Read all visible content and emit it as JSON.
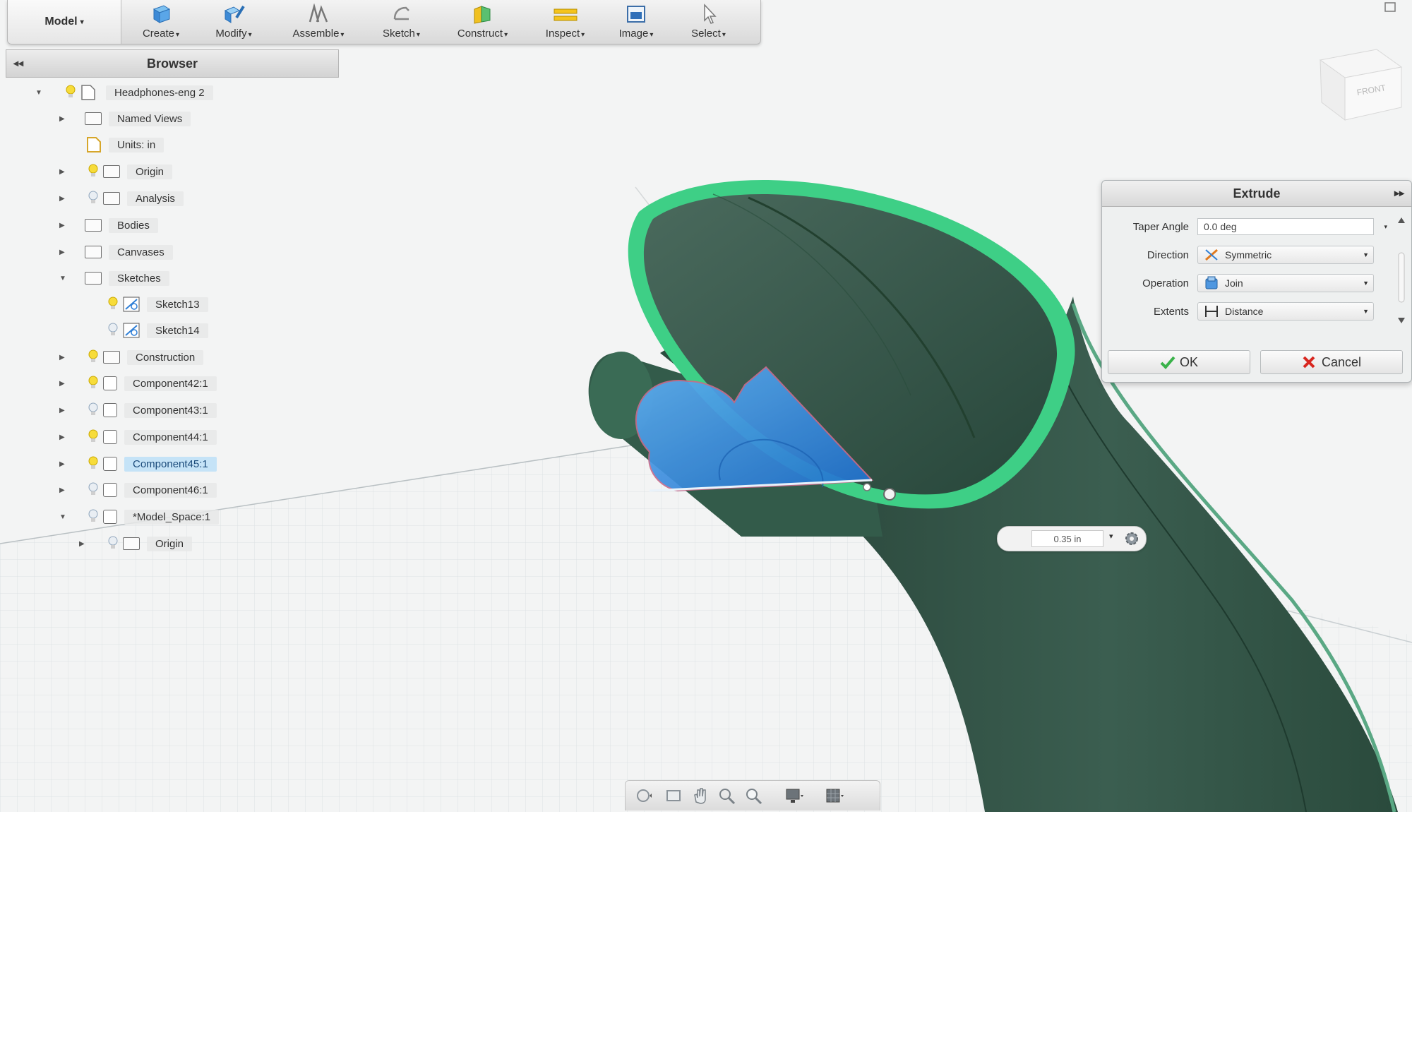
{
  "toolbar": {
    "workspace": "Model",
    "buttons": [
      {
        "label": "Create",
        "icon": "create-box-icon"
      },
      {
        "label": "Modify",
        "icon": "modify-icon"
      },
      {
        "label": "Assemble",
        "icon": "assemble-icon"
      },
      {
        "label": "Sketch",
        "icon": "sketch-icon"
      },
      {
        "label": "Construct",
        "icon": "construct-icon"
      },
      {
        "label": "Inspect",
        "icon": "inspect-icon"
      },
      {
        "label": "Image",
        "icon": "image-icon"
      },
      {
        "label": "Select",
        "icon": "select-cursor-icon"
      }
    ]
  },
  "browser": {
    "title": "Browser",
    "root": "Headphones-eng 2",
    "items": [
      {
        "label": "Named Views"
      },
      {
        "label": "Units: in"
      },
      {
        "label": "Origin"
      },
      {
        "label": "Analysis"
      },
      {
        "label": "Bodies"
      },
      {
        "label": "Canvases"
      },
      {
        "label": "Sketches"
      },
      {
        "label": "Sketch13"
      },
      {
        "label": "Sketch14"
      },
      {
        "label": "Construction"
      },
      {
        "label": "Component42:1"
      },
      {
        "label": "Component43:1"
      },
      {
        "label": "Component44:1"
      },
      {
        "label": "Component45:1",
        "selected": true
      },
      {
        "label": "Component46:1"
      },
      {
        "label": "*Model_Space:1"
      },
      {
        "label": "Origin"
      }
    ]
  },
  "viewcube": {
    "face": "FRONT"
  },
  "extrude": {
    "title": "Extrude",
    "fields": [
      {
        "label": "Taper Angle",
        "value": "0.0 deg"
      },
      {
        "label": "Direction",
        "value": "Symmetric",
        "icon": "symmetric-icon"
      },
      {
        "label": "Operation",
        "value": "Join",
        "icon": "join-icon"
      },
      {
        "label": "Extents",
        "value": "Distance",
        "icon": "distance-icon"
      }
    ],
    "ok": "OK",
    "cancel": "Cancel"
  },
  "dimension": {
    "value": "0.35 in"
  },
  "colors": {
    "accent": "#3a86d8",
    "body_green": "#2f6a4f",
    "rim_green": "#3fbf7f",
    "profile_blue": "#2f86e0"
  }
}
